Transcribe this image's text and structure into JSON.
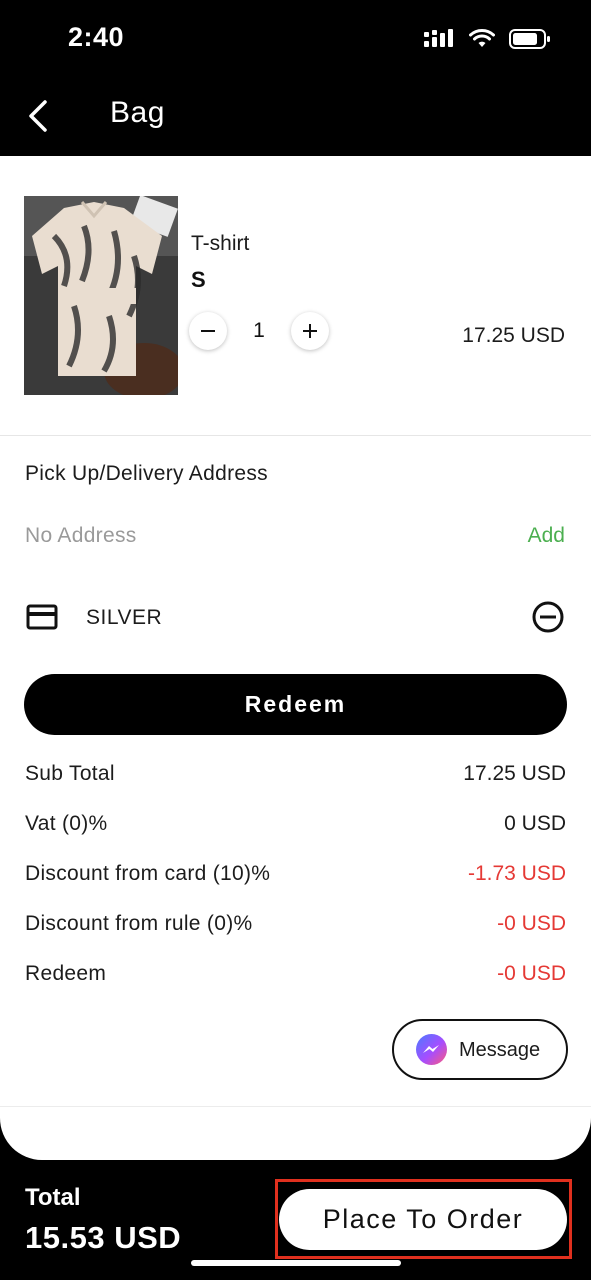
{
  "status_bar": {
    "time": "2:40"
  },
  "nav": {
    "title": "Bag"
  },
  "product": {
    "name": "T-shirt",
    "size": "S",
    "quantity": "1",
    "price": "17.25 USD"
  },
  "address": {
    "label": "Pick Up/Delivery Address",
    "value": "No Address",
    "add_label": "Add"
  },
  "card": {
    "name": "SILVER"
  },
  "redeem_button": "Redeem",
  "summary": [
    {
      "label": "Sub Total",
      "value": "17.25 USD"
    },
    {
      "label": "Vat (0)%",
      "value": "0 USD"
    },
    {
      "label": "Discount from card (10)%",
      "value": "-1.73 USD"
    },
    {
      "label": "Discount from rule (0)%",
      "value": "-0 USD"
    },
    {
      "label": "Redeem",
      "value": "-0 USD"
    }
  ],
  "message_button": "Message",
  "footer": {
    "total_label": "Total",
    "total_value": "15.53 USD",
    "order_button": "Place To Order"
  },
  "colors": {
    "accent": "#000000",
    "add_link": "#4caf50",
    "negative_value": "#e53935",
    "highlight_box": "#e0301e"
  },
  "icons": [
    "back-chevron-icon",
    "signal-icon",
    "wifi-icon",
    "battery-icon",
    "minus-icon",
    "plus-icon",
    "credit-card-icon",
    "remove-circle-icon",
    "messenger-icon"
  ]
}
